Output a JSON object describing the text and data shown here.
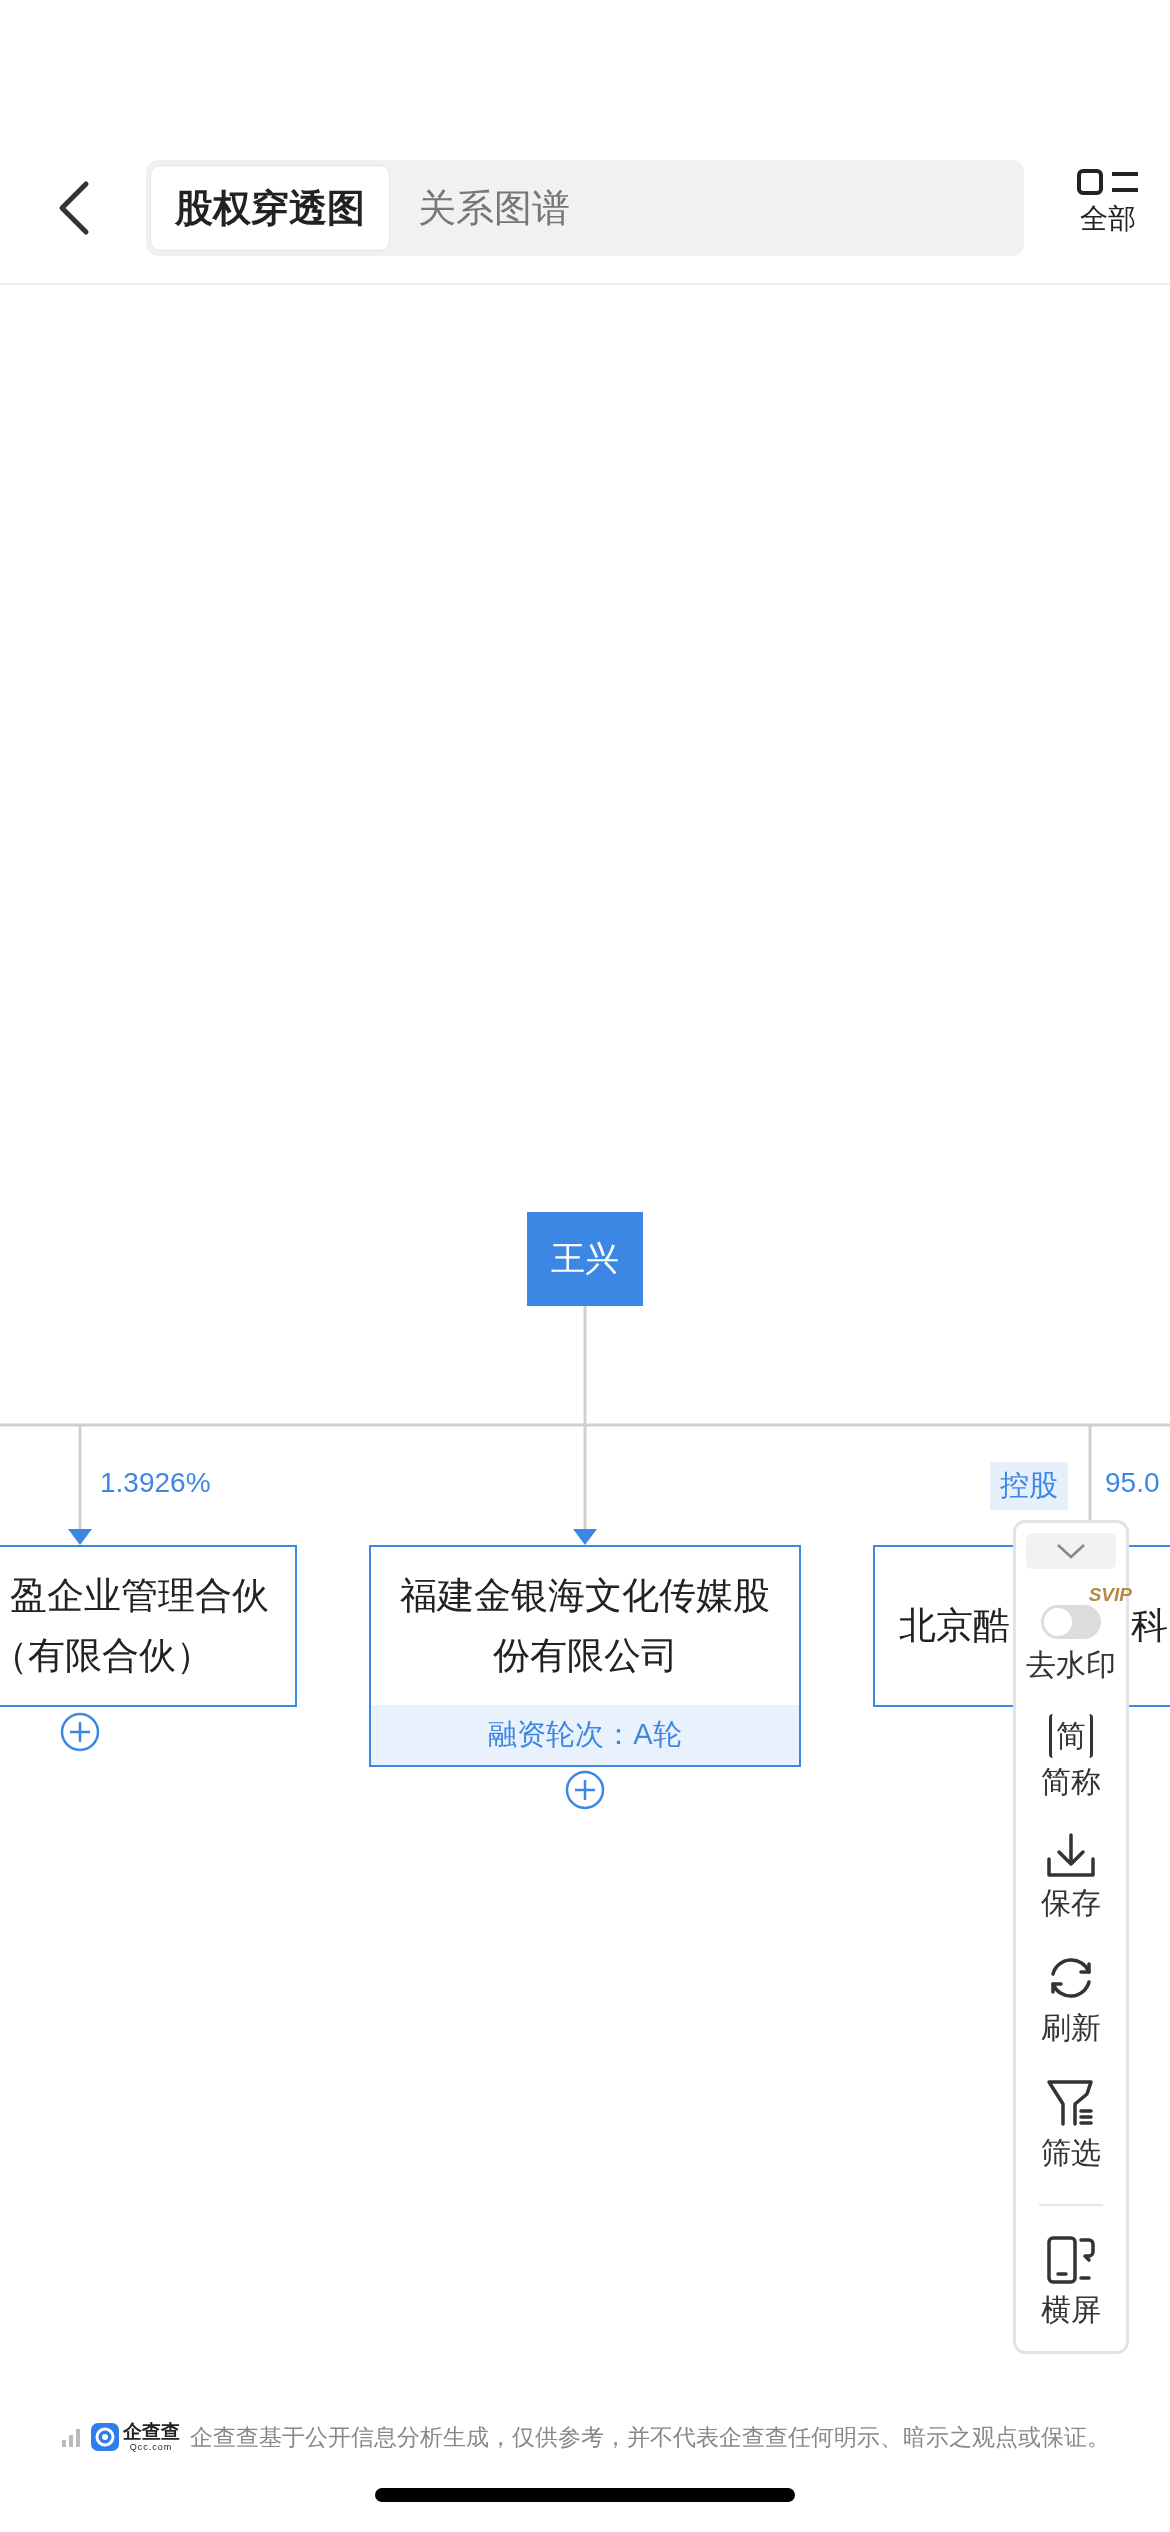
{
  "header": {
    "tabs": [
      {
        "label": "股权穿透图",
        "selected": true
      },
      {
        "label": "关系图谱",
        "selected": false
      }
    ],
    "menu_label": "全部"
  },
  "chart": {
    "root": "王兴",
    "branches": [
      {
        "kind": "left_cut",
        "percent": "1.3926%",
        "lines": [
          "盈企业管理合伙",
          "（有限合伙）"
        ],
        "expandable": true
      },
      {
        "kind": "full",
        "lines": [
          "福建金银海文化传媒股",
          "份有限公司"
        ],
        "footer": "融资轮次：A轮",
        "expandable": true
      },
      {
        "kind": "right_cut",
        "tag": "控股",
        "percent": "95.0",
        "lines": [
          "北京酷",
          "科"
        ],
        "expandable": false
      }
    ]
  },
  "tool_panel": {
    "items": [
      {
        "kind": "toggle",
        "badge": "SVIP",
        "label": "去水印",
        "on": false
      },
      {
        "kind": "glyph",
        "glyph": "简",
        "label": "简称"
      },
      {
        "kind": "download",
        "label": "保存"
      },
      {
        "kind": "refresh",
        "label": "刷新"
      },
      {
        "kind": "filter",
        "label": "筛选"
      },
      {
        "kind": "rotate",
        "label": "横屏",
        "divider_before": true
      }
    ]
  },
  "footer": {
    "logo_name": "企查查",
    "logo_domain": "Qcc.com",
    "disclaimer": "企查查基于公开信息分析生成，仅供参考，并不代表企查查任何明示、暗示之观点或保证。"
  }
}
